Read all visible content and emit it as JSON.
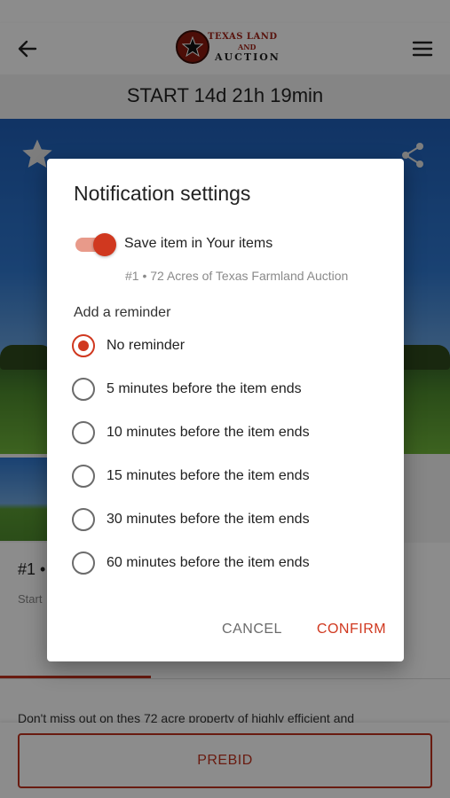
{
  "header": {
    "logo_line1": "TEXAS LAND",
    "logo_line2": "AND",
    "logo_line3": "AUCTION"
  },
  "countdown": "START 14d 21h 19min",
  "lot": {
    "title_visible": "#1 •",
    "subtitle_visible": "Start"
  },
  "description": "Don't miss out on thes 72 acre property of highly efficient and",
  "prebid_label": "PREBID",
  "dialog": {
    "title": "Notification settings",
    "save_label": "Save item in Your items",
    "save_enabled": true,
    "item_caption": "#1 • 72 Acres of Texas Farmland Auction",
    "reminder_heading": "Add a reminder",
    "options": [
      {
        "label": "No reminder",
        "selected": true
      },
      {
        "label": "5 minutes before the item ends",
        "selected": false
      },
      {
        "label": "10 minutes before the item ends",
        "selected": false
      },
      {
        "label": "15 minutes before the item ends",
        "selected": false
      },
      {
        "label": "30 minutes before the item ends",
        "selected": false
      },
      {
        "label": "60 minutes before the item ends",
        "selected": false
      }
    ],
    "cancel_label": "CANCEL",
    "confirm_label": "CONFIRM"
  },
  "colors": {
    "accent": "#d0381f",
    "scrim": "rgba(0,0,0,0.45)"
  },
  "icons": [
    "back-arrow-icon",
    "menu-icon",
    "star-icon",
    "share-icon",
    "logo-star-icon"
  ]
}
